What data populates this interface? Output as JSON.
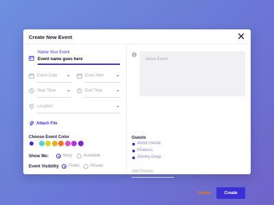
{
  "modal": {
    "title": "Create New Event"
  },
  "form": {
    "name_label": "Name Your Event",
    "name_value": "Event name goes here",
    "event_date_placeholder": "Event Date",
    "ends_after_placeholder": "Ends After",
    "start_time_placeholder": "Start Time",
    "end_time_placeholder": "End Time",
    "location_placeholder": "Location",
    "attach_file_label": "Attach File",
    "color_section_label": "Choose Event Color",
    "colors": [
      "#3b2fd6",
      "#57d0d6",
      "#e5d11e",
      "#f5a623",
      "#f0741e",
      "#e84ac4",
      "#a63be0",
      "#7a25d8"
    ],
    "show_me_label": "Show Me:",
    "show_me_options": [
      "Busy",
      "Available"
    ],
    "visibility_label": "Event Visibility",
    "visibility_options": [
      "Public",
      "Private"
    ]
  },
  "right": {
    "about_placeholder": "About Event",
    "guests_label": "Guests",
    "guests": [
      "Abdul Hamid",
      "Khalessi",
      "Johnny Depp"
    ],
    "add_guests_placeholder": "Add Guests"
  },
  "actions": {
    "cancel_label": "Cancel",
    "create_label": "Create"
  },
  "theme": {
    "accent": "#3b2fd6",
    "cancel": "#f07d12"
  }
}
